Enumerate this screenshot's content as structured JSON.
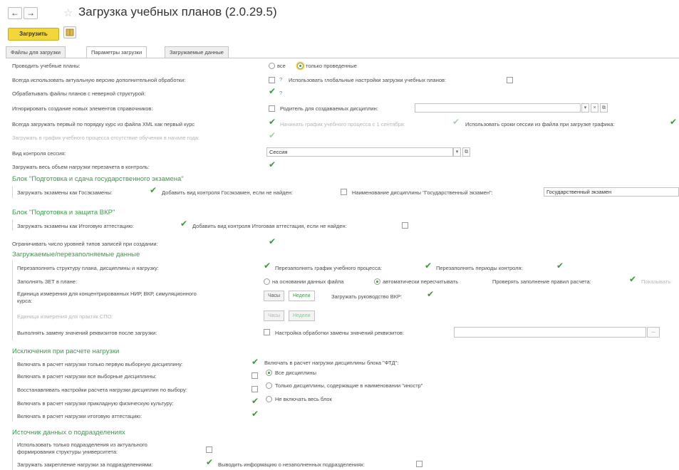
{
  "window": {
    "title": "Загрузка учебных планов (2.0.29.5)",
    "back_icon": "←",
    "forward_icon": "→",
    "star_icon": "☆"
  },
  "toolbar": {
    "load_label": "Загрузить",
    "help_icon": "question-icon"
  },
  "tabs": [
    "Файлы для загрузки",
    "Параметры загрузки",
    "Загружаемые данные"
  ],
  "general": {
    "conduct_label": "Проводить учебные планы:",
    "conduct_all": "все",
    "conduct_only": "только проведенные",
    "actual_versions_label": "Всегда использовать актуальную версию дополнительной обработки:",
    "q": "?",
    "global_settings_label": "Использовать глобальные настройки загрузки учебных планов:",
    "wrong_structure_label": "Обрабатывать файлы планов с неверной структурой:",
    "ignore_new_label": "Игнорировать создание новых элементов справочников:",
    "parent_label": "Родитель для создаваемых дисциплин:",
    "parent_value": "",
    "first_course_label": "Всегда загружать первый по порядку курс из файла XML как первый курс",
    "start_sept_label": "Начинать график учебного процесса с 1 сентября:",
    "session_dates_label": "Использовать сроки сессии из файла при загрузке графика:",
    "absence_label": "Загружать в график учебного процесса отсутствие обучения в начале года:",
    "control_kind_label": "Вид контроля сессия:",
    "control_kind_value": "Сессия",
    "whole_volume_label": "Загружать весь объем нагрузки перезачета в контроль:"
  },
  "gos_block": {
    "title": "Блок \"Подготовка и сдача государственного экзамена\"",
    "load_exams_label": "Загружать экзамены как Госэкзамены:",
    "add_control_label": "Добавить вид контроля Госэкзамен, если не найден:",
    "discipline_name_label": "Наименование дисциплины \"Государственный экзамен\":",
    "discipline_name_value": "Государственный экзамен"
  },
  "vkr_block": {
    "title": "Блок \"Подготовка и защита ВКР\"",
    "load_exams_label": "Загружать экзамены как Итоговую аттестацию:",
    "add_control_label": "Добавить вид контроля Итоговая аттестация, если не найден:"
  },
  "limit_levels_label": "Ограничивать число уровней типов записей при создании:",
  "loaded_data": {
    "title": "Загружаемые/перезаполняемые данные",
    "refill_structure_label": "Перезаполнять структуру плана, дисциплины и нагрузку:",
    "refill_schedule_label": "Перезаполнять график учебного процесса:",
    "refill_periods_label": "Перезаполнять периоды контроля:",
    "zet_label": "Заполнять ЗЕТ в плане:",
    "zet_from_file": "на основании данных файла",
    "zet_auto": "автоматически пересчитывать",
    "check_rules_label": "Проверять заполнение правил расчета:",
    "show_label": "Показывать",
    "unit_label_line1": "Единица измерения для концентрированных НИР, ВКР, симуляционного",
    "unit_label_line2": "курса:",
    "hours": "Часы",
    "weeks": "Недели",
    "load_vkr_label": "Загружать руководство ВКР:",
    "spo_unit_label": "Единица измерения для практик СПО:",
    "replace_label": "Выполнять замену значений реквизитов после загрузки:",
    "replace_settings_label": "Настройка обработки замены значений реквизитов:",
    "replace_value": "",
    "ellipsis": "..."
  },
  "exceptions": {
    "title": "Исключения при расчете нагрузки",
    "first_elective_label": "Включать в расчет нагрузки только первую выборную дисциплину:",
    "all_elective_label": "Включать в расчет нагрузки все выборные дисциплины:",
    "restore_label": "Восстанавливать настройки расчета нагрузки дисциплин по выбору:",
    "pe_label": "Включать в расчет нагрузки прикладную физическую культуру:",
    "final_label": "Включать в расчет нагрузки итоговую аттестацию:",
    "ftd_label": "Включать в расчет нагрузки дисциплины блока \"ФТД\":",
    "ftd_all": "Все дисциплины",
    "ftd_foreign": "Только дисциплины, содержащие в наименовании \"иностр\"",
    "ftd_none": "Не включать весь блок"
  },
  "departments": {
    "title": "Источник данных о подразделениях",
    "use_only_line1": "Использовать только подразделения из актуального",
    "use_only_line2": "формирования структуры университета:",
    "assign_label": "Загружать закрепление нагрузки за подразделениями:",
    "unassigned_label": "Выводить информацию о незаполненных подразделениях:"
  }
}
